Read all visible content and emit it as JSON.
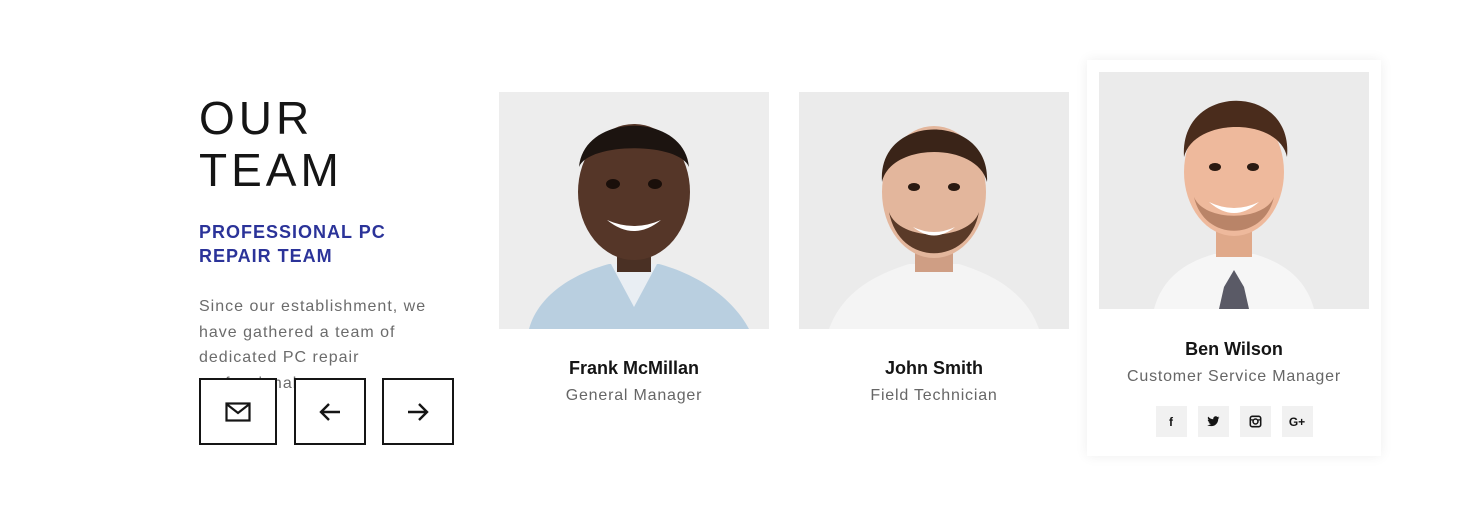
{
  "intro": {
    "title": "OUR TEAM",
    "subtitle": "PROFESSIONAL PC REPAIR TEAM",
    "description": "Since our establishment, we have gathered a team of dedicated PC repair professionals."
  },
  "controls": {
    "icons": [
      "mail-icon",
      "arrow-left-icon",
      "arrow-right-icon"
    ]
  },
  "team": [
    {
      "name": "Frank McMillan",
      "role": "General Manager"
    },
    {
      "name": "John Smith",
      "role": "Field Technician"
    },
    {
      "name": "Ben Wilson",
      "role": "Customer Service Manager"
    }
  ],
  "socials": {
    "facebook": "f",
    "twitter": "twitter-icon",
    "instagram": "instagram-icon",
    "google_plus": "G+"
  },
  "colors": {
    "accent": "#2b3399",
    "text_dark": "#151515",
    "text_muted": "#666666",
    "photo_bg": "#ededed"
  }
}
